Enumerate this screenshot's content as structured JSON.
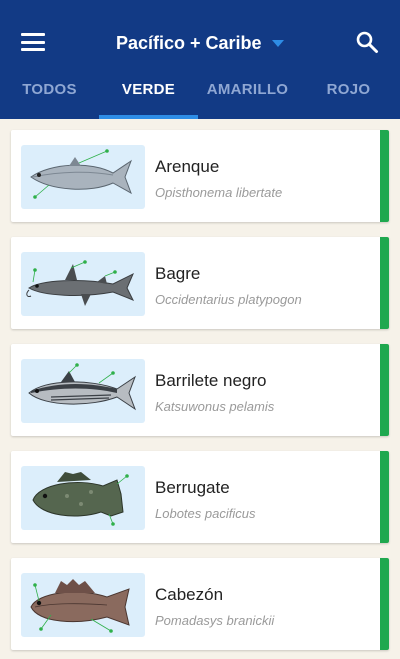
{
  "header": {
    "title": "Pacífico + Caribe",
    "menu_icon": "menu-icon",
    "search_icon": "search-icon",
    "dropdown_icon": "caret-down-icon",
    "background_color": "#123a85",
    "accent_color": "#2e8de6"
  },
  "tabs": [
    {
      "label": "TODOS",
      "active": false
    },
    {
      "label": "VERDE",
      "active": true
    },
    {
      "label": "AMARILLO",
      "active": false
    },
    {
      "label": "ROJO",
      "active": false
    }
  ],
  "species": [
    {
      "name": "Arenque",
      "scientific": "Opisthonema libertate",
      "status_color": "#1fa84f",
      "image": "herring-fish-illustration"
    },
    {
      "name": "Bagre",
      "scientific": "Occidentarius platypogon",
      "status_color": "#1fa84f",
      "image": "catfish-illustration"
    },
    {
      "name": "Barrilete negro",
      "scientific": "Katsuwonus pelamis",
      "status_color": "#1fa84f",
      "image": "skipjack-tuna-illustration"
    },
    {
      "name": "Berrugate",
      "scientific": "Lobotes pacificus",
      "status_color": "#1fa84f",
      "image": "tripletail-fish-illustration"
    },
    {
      "name": "Cabezón",
      "scientific": "Pomadasys branickii",
      "status_color": "#1fa84f",
      "image": "grunt-fish-illustration"
    }
  ]
}
